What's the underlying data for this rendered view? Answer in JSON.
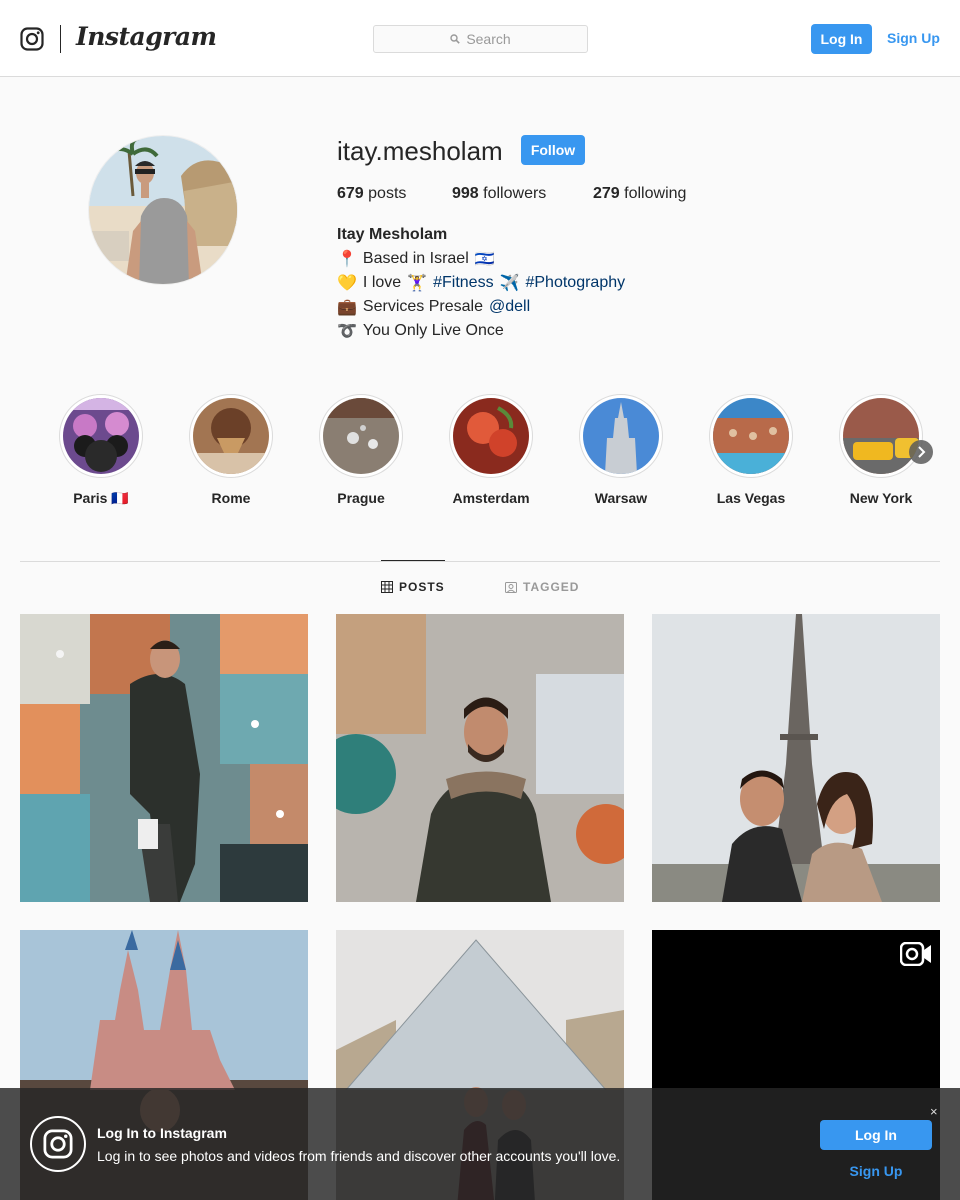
{
  "header": {
    "brand": "Instagram",
    "search_placeholder": "Search",
    "login_label": "Log In",
    "signup_label": "Sign Up"
  },
  "profile": {
    "username": "itay.mesholam",
    "follow_label": "Follow",
    "posts_count": "679",
    "posts_label": "posts",
    "followers_count": "998",
    "followers_label": "followers",
    "following_count": "279",
    "following_label": "following",
    "full_name": "Itay Mesholam",
    "bio": {
      "line1_icon": "📍",
      "line1_text": "Based in Israel",
      "line1_flag": "🇮🇱",
      "line2_icon": "💛",
      "line2_text": "I love",
      "line2_emoji": "🏋️‍♀️",
      "line2_tag1": "#Fitness",
      "line2_emoji2": "✈️",
      "line2_tag2": "#Photography",
      "line3_icon": "💼",
      "line3_text": "Services Presale",
      "line3_mention": "@dell",
      "line4_icon": "➰",
      "line4_text": "You Only Live Once"
    }
  },
  "highlights": [
    {
      "label": "Paris 🇫🇷"
    },
    {
      "label": "Rome"
    },
    {
      "label": "Prague"
    },
    {
      "label": "Amsterdam"
    },
    {
      "label": "Warsaw"
    },
    {
      "label": "Las Vegas"
    },
    {
      "label": "New York"
    }
  ],
  "tabs": {
    "posts": "POSTS",
    "tagged": "TAGGED"
  },
  "banner": {
    "title": "Log In to Instagram",
    "text": "Log in to see photos and videos from friends and discover other accounts you'll love.",
    "login_label": "Log In",
    "signup_label": "Sign Up",
    "close": "×"
  },
  "colors": {
    "accent": "#3897f0",
    "text": "#262626",
    "hashtag": "#003569"
  }
}
